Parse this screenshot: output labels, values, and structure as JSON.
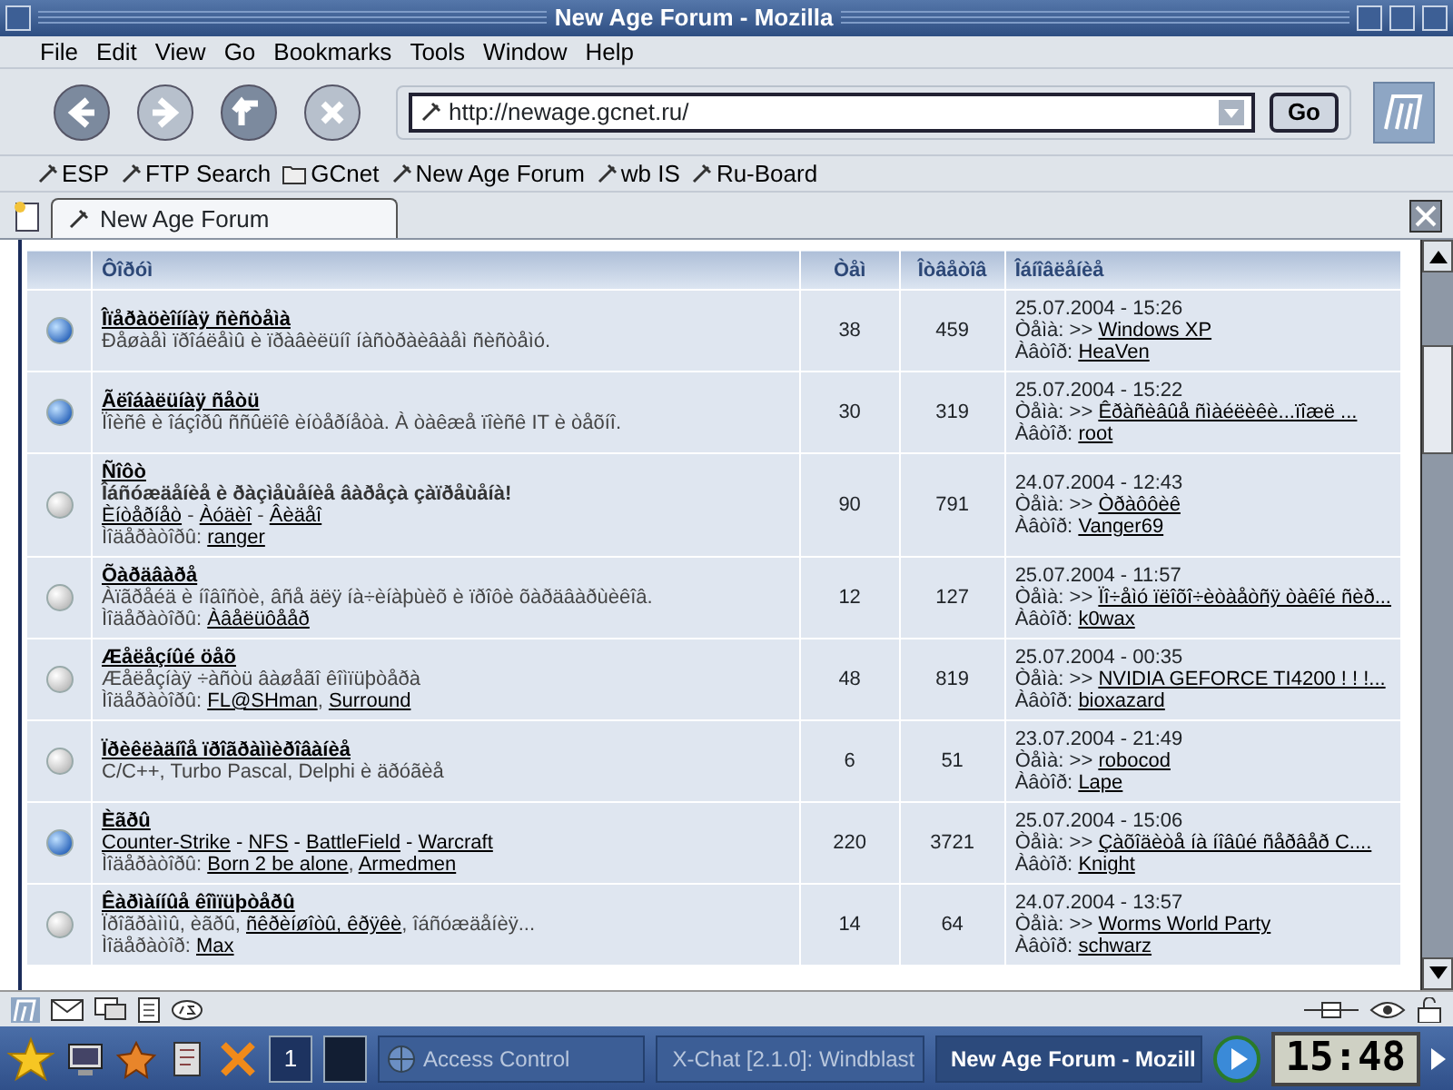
{
  "window": {
    "title": "New Age Forum - Mozilla"
  },
  "menu": [
    "File",
    "Edit",
    "View",
    "Go",
    "Bookmarks",
    "Tools",
    "Window",
    "Help"
  ],
  "nav_buttons": [
    {
      "kind": "back",
      "disabled": false
    },
    {
      "kind": "forward",
      "disabled": true
    },
    {
      "kind": "reload",
      "disabled": false
    },
    {
      "kind": "stop",
      "disabled": true
    }
  ],
  "url": "http://newage.gcnet.ru/",
  "go_button": "Go",
  "bookmarks": [
    {
      "label": "ESP",
      "kind": "link"
    },
    {
      "label": "FTP Search",
      "kind": "link"
    },
    {
      "label": "GCnet",
      "kind": "folder"
    },
    {
      "label": "New Age Forum",
      "kind": "link"
    },
    {
      "label": "wb IS",
      "kind": "link"
    },
    {
      "label": "Ru-Board",
      "kind": "link"
    }
  ],
  "tabs": [
    {
      "label": "New Age Forum",
      "selected": true
    }
  ],
  "forum": {
    "columns": [
      "Ôîðóì",
      "Òåì",
      "Îòâåòîâ",
      "Îáíîâëåíèå"
    ],
    "rows": [
      {
        "new": true,
        "title": "Îïåðàöèîííàÿ ñèñòåìà",
        "lines": [
          {
            "kind": "description",
            "parts": [
              {
                "text": "Ðåøàåì ïðîáëåìû è ïðàâèëüíî íàñòðàèâàåì ñèñòåìó.",
                "link": false
              }
            ]
          }
        ],
        "topics": "38",
        "replies": "459",
        "last": {
          "date": "25.07.2004 - 15:26",
          "topic_label": "Òåìà: >>",
          "topic": "Windows XP",
          "author_label": "Àâòîð:",
          "author": "HeaVen"
        }
      },
      {
        "new": true,
        "title": "Ãëîáàëüíàÿ ñåòü",
        "lines": [
          {
            "kind": "description",
            "parts": [
              {
                "text": "Ïîèñê è îáçîðû ññûëîê èíòåðíåòà. À òàêæå ïîèñê IT è òåõíî.",
                "link": false
              }
            ]
          }
        ],
        "topics": "30",
        "replies": "319",
        "last": {
          "date": "25.07.2004 - 15:22",
          "topic_label": "Òåìà: >>",
          "topic": "Êðàñèâûå ñìàéëèêè...ïîæë ...",
          "author_label": "Àâòîð:",
          "author": "root"
        }
      },
      {
        "new": false,
        "title": "Ñîôò",
        "lines": [
          {
            "kind": "bold",
            "parts": [
              {
                "text": "Îáñóæäåíèå è ðàçìåùåíèå âàðåçà çàïðåùåíà!",
                "link": false
              }
            ]
          },
          {
            "kind": "description",
            "parts": [
              {
                "text": "Èíòåðíåò",
                "link": true
              },
              {
                "text": " - ",
                "link": false
              },
              {
                "text": "Àóäèî",
                "link": true
              },
              {
                "text": " - ",
                "link": false
              },
              {
                "text": "Âèäåî",
                "link": true
              }
            ]
          },
          {
            "kind": "moderators",
            "parts": [
              {
                "text": "Ìîäåðàòîðû:",
                "link": false
              },
              {
                "text": "ranger",
                "link": true
              }
            ]
          }
        ],
        "topics": "90",
        "replies": "791",
        "last": {
          "date": "24.07.2004 - 12:43",
          "topic_label": "Òåìà: >>",
          "topic": "Òðàôôèê",
          "author_label": "Àâòîð:",
          "author": "Vanger69"
        }
      },
      {
        "new": false,
        "title": "Õàðäâàðå",
        "lines": [
          {
            "kind": "description",
            "parts": [
              {
                "text": "Àïãðåéä è íîâîñòè, âñå äëÿ íà÷èíàþùèõ è ïðîôè õàðäâàðùèêîâ.",
                "link": false
              }
            ]
          },
          {
            "kind": "moderators",
            "parts": [
              {
                "text": "Ìîäåðàòîðû:",
                "link": false
              },
              {
                "text": "Àâåëüôååð",
                "link": true
              }
            ]
          }
        ],
        "topics": "12",
        "replies": "127",
        "last": {
          "date": "25.07.2004 - 11:57",
          "topic_label": "Òåìà: >>",
          "topic": "Ïî÷åìó ïëîõî÷èòàåòñÿ òàêîé ñèð...",
          "author_label": "Àâòîð:",
          "author": "k0wax"
        }
      },
      {
        "new": false,
        "title": "Æåëåçíûé öåõ",
        "lines": [
          {
            "kind": "description",
            "parts": [
              {
                "text": "Æåëåçíàÿ ÷àñòü âàøåãî êîìïüþòåðà",
                "link": false
              }
            ]
          },
          {
            "kind": "moderators",
            "parts": [
              {
                "text": "Ìîäåðàòîðû:",
                "link": false
              },
              {
                "text": "FL@SHman",
                "link": true
              },
              {
                "text": ",",
                "link": false
              },
              {
                "text": "Surround",
                "link": true
              }
            ]
          }
        ],
        "topics": "48",
        "replies": "819",
        "last": {
          "date": "25.07.2004 - 00:35",
          "topic_label": "Òåìà: >>",
          "topic": "NVIDIA GEFORCE TI4200 ! ! !...",
          "author_label": "Àâòîð:",
          "author": "bioxazard"
        }
      },
      {
        "new": false,
        "title": "Ïðèêëàäíîå ïðîãðàììèðîâàíèå",
        "lines": [
          {
            "kind": "description",
            "parts": [
              {
                "text": "C/C++, Turbo Pascal, Delphi è äðóãèå",
                "link": false
              }
            ]
          }
        ],
        "topics": "6",
        "replies": "51",
        "last": {
          "date": "23.07.2004 - 21:49",
          "topic_label": "Òåìà: >>",
          "topic": "robocod",
          "author_label": "Àâòîð:",
          "author": "Lape"
        }
      },
      {
        "new": true,
        "title": "Èãðû",
        "lines": [
          {
            "kind": "games",
            "parts": [
              {
                "text": "Counter-Strike",
                "link": true
              },
              {
                "text": " - ",
                "link": false
              },
              {
                "text": "NFS",
                "link": true
              },
              {
                "text": " - ",
                "link": false
              },
              {
                "text": "BattleField",
                "link": true
              },
              {
                "text": " - ",
                "link": false
              },
              {
                "text": "Warcraft",
                "link": true
              }
            ]
          },
          {
            "kind": "moderators",
            "parts": [
              {
                "text": "Ìîäåðàòîðû:",
                "link": false
              },
              {
                "text": "Born 2 be alone",
                "link": true
              },
              {
                "text": ",",
                "link": false
              },
              {
                "text": "Armedmen",
                "link": true
              }
            ]
          }
        ],
        "topics": "220",
        "replies": "3721",
        "last": {
          "date": "25.07.2004 - 15:06",
          "topic_label": "Òåìà: >>",
          "topic": "Çàõîäèòå íà íîâûé ñåðâåð C....",
          "author_label": "Àâòîð:",
          "author": "Knight"
        }
      },
      {
        "new": false,
        "title": "Êàðìàííûå êîìïüþòåðû",
        "lines": [
          {
            "kind": "description",
            "parts": [
              {
                "text": "Ïðîãðàììû, èãðû,",
                "link": false
              },
              {
                "text": "ñêðèíøîòû, êðÿêè",
                "link": true
              },
              {
                "text": ", îáñóæäåíèÿ...",
                "link": false
              }
            ]
          },
          {
            "kind": "moderators",
            "parts": [
              {
                "text": "Ìîäåðàòîð:",
                "link": false
              },
              {
                "text": "Max",
                "link": true
              }
            ]
          }
        ],
        "topics": "14",
        "replies": "64",
        "last": {
          "date": "24.07.2004 - 13:57",
          "topic_label": "Òåìà: >>",
          "topic": "Worms World Party",
          "author_label": "Àâòîð:",
          "author": "schwarz"
        }
      }
    ]
  },
  "taskbar": {
    "pager": [
      {
        "label": "1",
        "selected": true
      },
      {
        "selected": false
      }
    ],
    "tasks": [
      {
        "label": "Access Control",
        "kind": "globe",
        "selected": false
      },
      {
        "label": "X-Chat [2.1.0]: Windblast",
        "kind": "chat",
        "selected": false
      },
      {
        "label": "New Age Forum - Mozill",
        "kind": "browser",
        "selected": true
      }
    ],
    "clock": "15:48"
  }
}
